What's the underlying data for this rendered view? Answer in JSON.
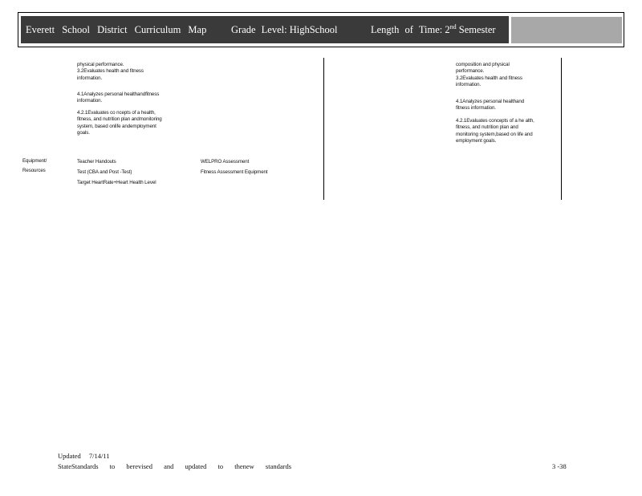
{
  "header": {
    "district": "Everett School District Curriculum Map",
    "grade_label": "Grade Level:",
    "grade_value": "HighSchool",
    "length_label": "Length of Time:",
    "length_num": "2",
    "length_sup": "nd",
    "length_value": "Semester"
  },
  "left_column": {
    "performance_text": "physical performance.\n3.2Evaluates health and fitness\ninformation.",
    "analyzes_text": "4.1Analyzes personal healthandfitness\ninformation.",
    "evaluates_text": "4.2.1Evaluates co ncepts of a health,\nfitness, and nutrition plan andmonitoring\nsystem, based onlife andemployment\ngoals."
  },
  "equipment": {
    "label": "Equipment/\nResources",
    "items_left": "Teacher Handouts\nTest (CBA and Post -Test)\nTarget HeartRate+Heart Health Level",
    "items_right": "WELPRO Assessment\nFitness Assessment Equipment"
  },
  "right_column": {
    "composition_text": "composition and physical\nperformance.\n3.2Evaluates health and fitness\ninformation.",
    "analyzes_text": "4.1Analyzes personal healthand\nfitness information.",
    "evaluates_text": "4.2.1Evaluates concepts of a he alth,\nfitness, and nutrition plan and\nmonitoring system,based on life and\nemployment goals."
  },
  "footer": {
    "updated": "Updated 7/14/11",
    "standards_note": "StateStandards to berevised and updated to thenew standards",
    "page_number": "3 -38"
  }
}
